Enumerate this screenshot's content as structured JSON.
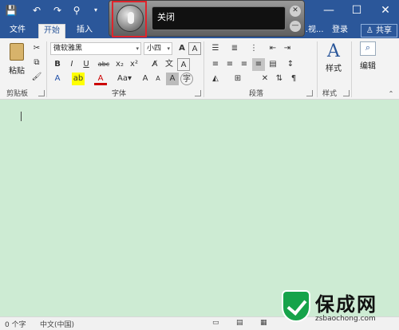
{
  "quick_access": {
    "save_icon": "save-icon",
    "undo_icon": "undo-icon",
    "redo_icon": "redo-icon",
    "touch_icon": "touch-mode-icon"
  },
  "window_controls": {
    "minimize": "—",
    "maximize": "☐",
    "close": "✕"
  },
  "tabs": [
    {
      "label": "文件"
    },
    {
      "label": "开始",
      "active": true
    },
    {
      "label": "插入"
    },
    {
      "label": "…视..."
    }
  ],
  "account": {
    "login": "登录",
    "share": "共享"
  },
  "ribbon": {
    "clipboard": {
      "label": "剪贴板",
      "paste": "粘贴"
    },
    "font": {
      "label": "字体",
      "name": "微软雅黑",
      "size": "小四"
    },
    "paragraph": {
      "label": "段落"
    },
    "styles": {
      "label": "样式",
      "button": "样式"
    },
    "editing": {
      "button": "编辑"
    }
  },
  "speech_bar": {
    "status": "关闭"
  },
  "status": {
    "word_count": "0 个字",
    "language": "中文(中国)"
  },
  "watermark": {
    "title": "保成网",
    "url": "zsbaochong.com"
  },
  "colors": {
    "accent": "#2b579a",
    "document_bg": "#cdebd3",
    "highlight": "#e0242c"
  }
}
